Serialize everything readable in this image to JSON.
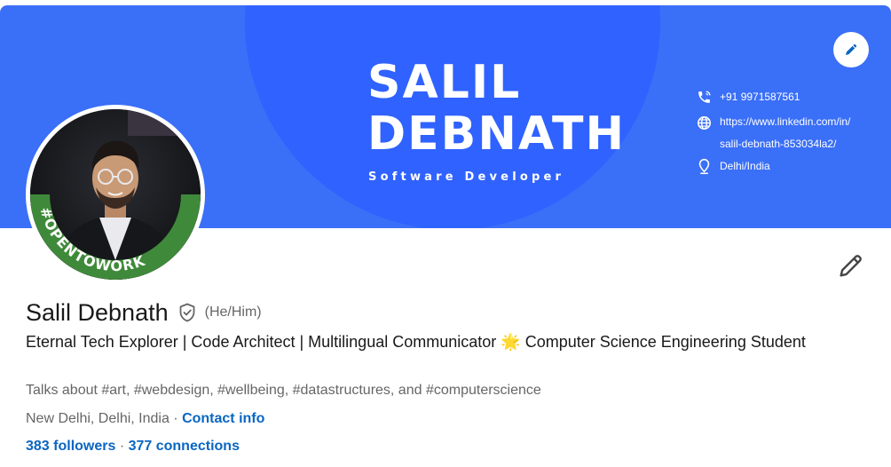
{
  "banner": {
    "name_line1": "SALIL",
    "name_line2": "DEBNATH",
    "role": "Software Developer",
    "phone": "+91 9971587561",
    "website_line1": "https://www.linkedin.com/in/",
    "website_line2": "salil-debnath-853034la2/",
    "location": "Delhi/India"
  },
  "avatar": {
    "frame_text": "#OPENTOWORK",
    "frame_color": "#3f8a3a"
  },
  "profile": {
    "name": "Salil Debnath",
    "pronouns": "(He/Him)",
    "headline_part1": "Eternal Tech Explorer | Code Architect | Multilingual Communicator ",
    "headline_emoji": "🌟",
    "headline_part2": " Computer Science Engineering Student",
    "talks_about": "Talks about #art, #webdesign, #wellbeing, #datastructures, and #computerscience",
    "location": "New Delhi, Delhi, India",
    "separator": " · ",
    "contact_info": "Contact info",
    "followers": "383 followers",
    "connections_separator": " · ",
    "connections": "377 connections"
  },
  "colors": {
    "banner": "#3a6ff7",
    "banner_circle": "#2f62ff",
    "link": "#0a66c2",
    "open_to_work": "#3f8a3a"
  },
  "icons": [
    "pencil-icon",
    "phone-icon",
    "globe-icon",
    "location-pin-icon",
    "verified-shield-icon"
  ]
}
